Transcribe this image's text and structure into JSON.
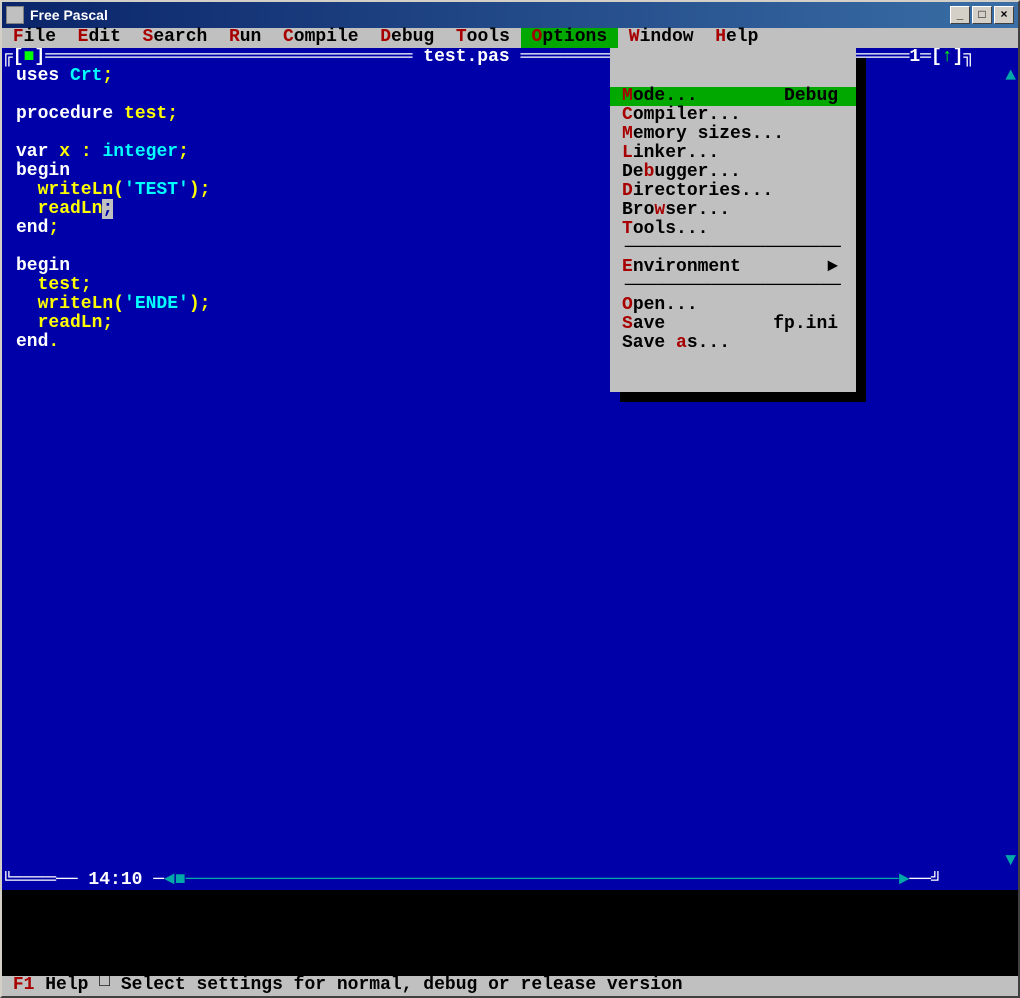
{
  "window": {
    "title": "Free Pascal"
  },
  "menubar": {
    "items": [
      {
        "label": "File",
        "hotkey_index": 0
      },
      {
        "label": "Edit",
        "hotkey_index": 0
      },
      {
        "label": "Search",
        "hotkey_index": 0
      },
      {
        "label": "Run",
        "hotkey_index": 0
      },
      {
        "label": "Compile",
        "hotkey_index": 0
      },
      {
        "label": "Debug",
        "hotkey_index": 0
      },
      {
        "label": "Tools",
        "hotkey_index": 0
      },
      {
        "label": "Options",
        "hotkey_index": 0,
        "selected": true
      },
      {
        "label": "Window",
        "hotkey_index": 0
      },
      {
        "label": "Help",
        "hotkey_index": 0
      }
    ]
  },
  "editor_frame": {
    "filename": "test.pas",
    "window_number": "1",
    "cursor_position": "14:10"
  },
  "code_lines": [
    {
      "tokens": [
        {
          "t": "uses ",
          "c": "white"
        },
        {
          "t": "Crt",
          "c": "cyan"
        },
        {
          "t": ";",
          "c": "yellow"
        }
      ]
    },
    {
      "tokens": []
    },
    {
      "tokens": [
        {
          "t": "procedure ",
          "c": "white"
        },
        {
          "t": "test",
          "c": "yellow"
        },
        {
          "t": ";",
          "c": "yellow"
        }
      ]
    },
    {
      "tokens": []
    },
    {
      "tokens": [
        {
          "t": "var ",
          "c": "white"
        },
        {
          "t": "x ",
          "c": "yellow"
        },
        {
          "t": ": ",
          "c": "yellow"
        },
        {
          "t": "integer",
          "c": "cyan"
        },
        {
          "t": ";",
          "c": "yellow"
        }
      ]
    },
    {
      "tokens": [
        {
          "t": "begin",
          "c": "white"
        }
      ]
    },
    {
      "tokens": [
        {
          "t": "  writeLn",
          "c": "yellow"
        },
        {
          "t": "(",
          "c": "yellow"
        },
        {
          "t": "'TEST'",
          "c": "cyan"
        },
        {
          "t": ")",
          "c": "yellow"
        },
        {
          "t": ";",
          "c": "yellow"
        }
      ]
    },
    {
      "tokens": [
        {
          "t": "  readLn",
          "c": "yellow"
        },
        {
          "t": ";",
          "c": "yellow",
          "cursor": true
        }
      ]
    },
    {
      "tokens": [
        {
          "t": "end",
          "c": "white"
        },
        {
          "t": ";",
          "c": "yellow"
        }
      ]
    },
    {
      "tokens": []
    },
    {
      "tokens": [
        {
          "t": "begin",
          "c": "white"
        }
      ]
    },
    {
      "tokens": [
        {
          "t": "  test",
          "c": "yellow"
        },
        {
          "t": ";",
          "c": "yellow"
        }
      ]
    },
    {
      "tokens": [
        {
          "t": "  writeLn",
          "c": "yellow"
        },
        {
          "t": "(",
          "c": "yellow"
        },
        {
          "t": "'ENDE'",
          "c": "cyan"
        },
        {
          "t": ")",
          "c": "yellow"
        },
        {
          "t": ";",
          "c": "yellow"
        }
      ]
    },
    {
      "tokens": [
        {
          "t": "  readLn",
          "c": "yellow"
        },
        {
          "t": ";",
          "c": "yellow"
        }
      ]
    },
    {
      "tokens": [
        {
          "t": "end",
          "c": "white"
        },
        {
          "t": ".",
          "c": "yellow"
        }
      ]
    }
  ],
  "options_menu": {
    "items": [
      {
        "label": "Mode...",
        "hotkey_index": 0,
        "shortcut": "Debug",
        "selected": true
      },
      {
        "label": "Compiler...",
        "hotkey_index": 0
      },
      {
        "label": "Memory sizes...",
        "hotkey_index": 0
      },
      {
        "label": "Linker...",
        "hotkey_index": 0
      },
      {
        "label": "Debugger...",
        "hotkey_index": 2
      },
      {
        "label": "Directories...",
        "hotkey_index": 0
      },
      {
        "label": "Browser...",
        "hotkey_index": 3
      },
      {
        "label": "Tools...",
        "hotkey_index": 0
      },
      {
        "separator": true
      },
      {
        "label": "Environment",
        "hotkey_index": 0,
        "submenu": true
      },
      {
        "separator": true
      },
      {
        "label": "Open...",
        "hotkey_index": 0
      },
      {
        "label": "Save",
        "hotkey_index": 0,
        "shortcut": "fp.ini"
      },
      {
        "label": "Save as...",
        "hotkey_index": 5
      }
    ]
  },
  "statusbar": {
    "key": "F1",
    "label": "Help",
    "hint": "Select settings for normal, debug or release version"
  }
}
